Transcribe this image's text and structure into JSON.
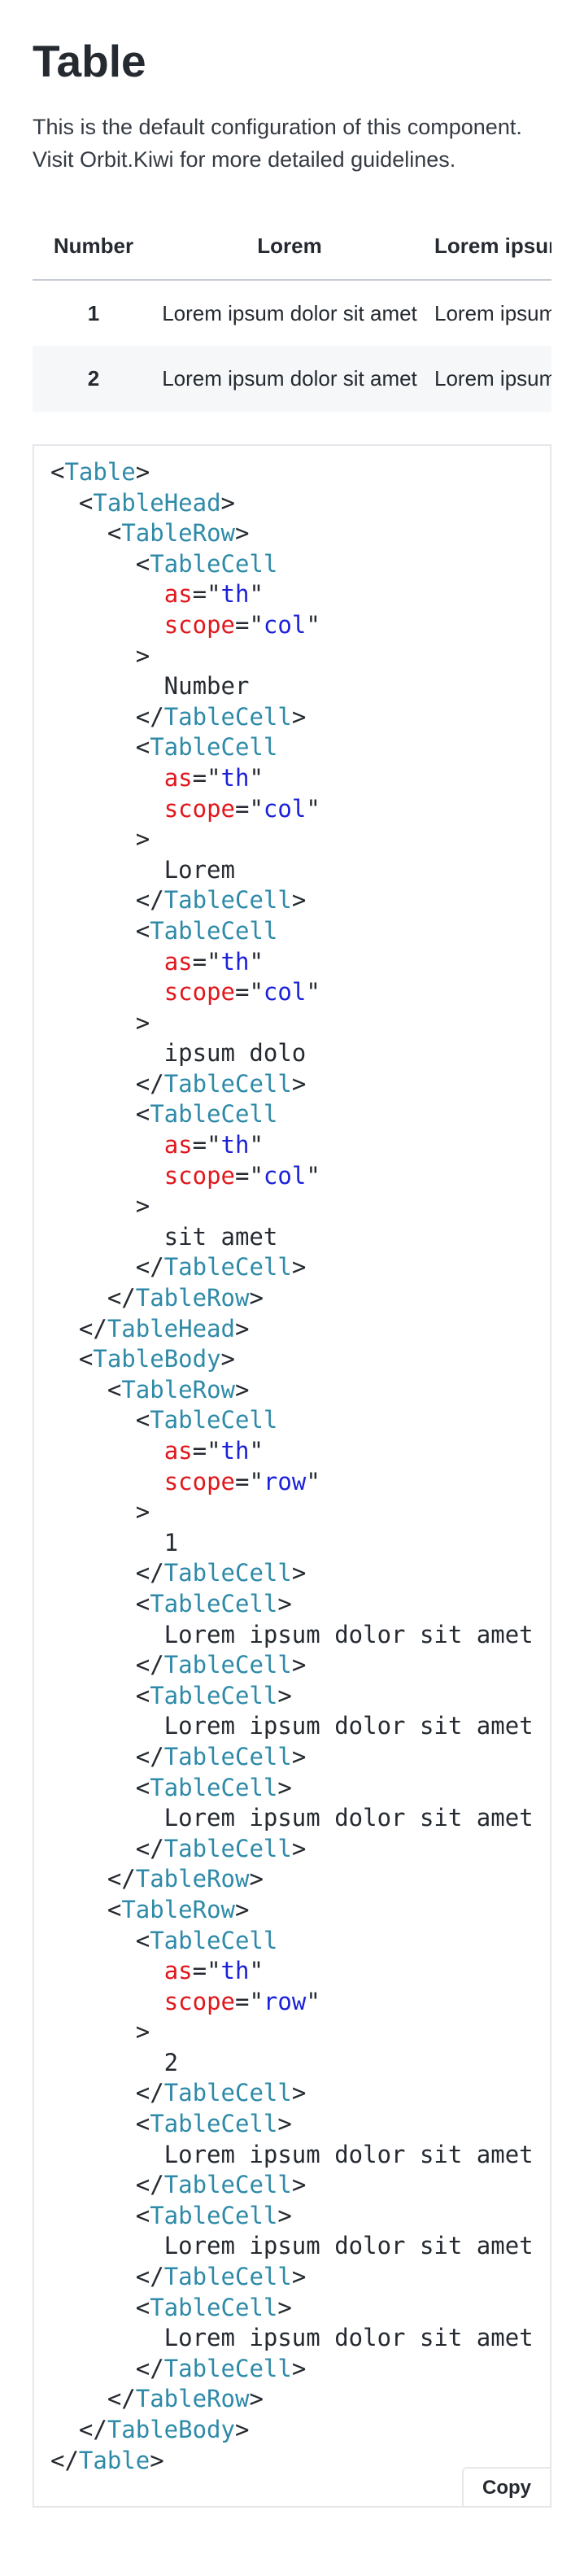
{
  "page": {
    "title": "Table",
    "description_line1": "This is the default configuration of this component.",
    "description_line2": "Visit Orbit.Kiwi for more detailed guidelines."
  },
  "table": {
    "headers": [
      "Number",
      "Lorem",
      "Lorem ipsum dolo"
    ],
    "rows": [
      {
        "number": "1",
        "cells": [
          "Lorem ipsum dolor sit amet",
          "Lorem ipsum dolor sit amet"
        ]
      },
      {
        "number": "2",
        "cells": [
          "Lorem ipsum dolor sit amet",
          "Lorem ipsum dolor sit amet"
        ]
      }
    ]
  },
  "code": {
    "lines": [
      [
        [
          0,
          "<"
        ],
        [
          1,
          "Table"
        ],
        [
          0,
          ">"
        ]
      ],
      [
        [
          0,
          "  <"
        ],
        [
          1,
          "TableHead"
        ],
        [
          0,
          ">"
        ]
      ],
      [
        [
          0,
          "    <"
        ],
        [
          1,
          "TableRow"
        ],
        [
          0,
          ">"
        ]
      ],
      [
        [
          0,
          "      <"
        ],
        [
          1,
          "TableCell"
        ]
      ],
      [
        [
          0,
          "        "
        ],
        [
          2,
          "as"
        ],
        [
          0,
          "=\""
        ],
        [
          3,
          "th"
        ],
        [
          0,
          "\""
        ]
      ],
      [
        [
          0,
          "        "
        ],
        [
          2,
          "scope"
        ],
        [
          0,
          "=\""
        ],
        [
          3,
          "col"
        ],
        [
          0,
          "\""
        ]
      ],
      [
        [
          0,
          "      >"
        ]
      ],
      [
        [
          0,
          "        Number"
        ]
      ],
      [
        [
          0,
          "      </"
        ],
        [
          1,
          "TableCell"
        ],
        [
          0,
          ">"
        ]
      ],
      [
        [
          0,
          "      <"
        ],
        [
          1,
          "TableCell"
        ]
      ],
      [
        [
          0,
          "        "
        ],
        [
          2,
          "as"
        ],
        [
          0,
          "=\""
        ],
        [
          3,
          "th"
        ],
        [
          0,
          "\""
        ]
      ],
      [
        [
          0,
          "        "
        ],
        [
          2,
          "scope"
        ],
        [
          0,
          "=\""
        ],
        [
          3,
          "col"
        ],
        [
          0,
          "\""
        ]
      ],
      [
        [
          0,
          "      >"
        ]
      ],
      [
        [
          0,
          "        Lorem"
        ]
      ],
      [
        [
          0,
          "      </"
        ],
        [
          1,
          "TableCell"
        ],
        [
          0,
          ">"
        ]
      ],
      [
        [
          0,
          "      <"
        ],
        [
          1,
          "TableCell"
        ]
      ],
      [
        [
          0,
          "        "
        ],
        [
          2,
          "as"
        ],
        [
          0,
          "=\""
        ],
        [
          3,
          "th"
        ],
        [
          0,
          "\""
        ]
      ],
      [
        [
          0,
          "        "
        ],
        [
          2,
          "scope"
        ],
        [
          0,
          "=\""
        ],
        [
          3,
          "col"
        ],
        [
          0,
          "\""
        ]
      ],
      [
        [
          0,
          "      >"
        ]
      ],
      [
        [
          0,
          "        ipsum dolo"
        ]
      ],
      [
        [
          0,
          "      </"
        ],
        [
          1,
          "TableCell"
        ],
        [
          0,
          ">"
        ]
      ],
      [
        [
          0,
          "      <"
        ],
        [
          1,
          "TableCell"
        ]
      ],
      [
        [
          0,
          "        "
        ],
        [
          2,
          "as"
        ],
        [
          0,
          "=\""
        ],
        [
          3,
          "th"
        ],
        [
          0,
          "\""
        ]
      ],
      [
        [
          0,
          "        "
        ],
        [
          2,
          "scope"
        ],
        [
          0,
          "=\""
        ],
        [
          3,
          "col"
        ],
        [
          0,
          "\""
        ]
      ],
      [
        [
          0,
          "      >"
        ]
      ],
      [
        [
          0,
          "        sit amet"
        ]
      ],
      [
        [
          0,
          "      </"
        ],
        [
          1,
          "TableCell"
        ],
        [
          0,
          ">"
        ]
      ],
      [
        [
          0,
          "    </"
        ],
        [
          1,
          "TableRow"
        ],
        [
          0,
          ">"
        ]
      ],
      [
        [
          0,
          "  </"
        ],
        [
          1,
          "TableHead"
        ],
        [
          0,
          ">"
        ]
      ],
      [
        [
          0,
          "  <"
        ],
        [
          1,
          "TableBody"
        ],
        [
          0,
          ">"
        ]
      ],
      [
        [
          0,
          "    <"
        ],
        [
          1,
          "TableRow"
        ],
        [
          0,
          ">"
        ]
      ],
      [
        [
          0,
          "      <"
        ],
        [
          1,
          "TableCell"
        ]
      ],
      [
        [
          0,
          "        "
        ],
        [
          2,
          "as"
        ],
        [
          0,
          "=\""
        ],
        [
          3,
          "th"
        ],
        [
          0,
          "\""
        ]
      ],
      [
        [
          0,
          "        "
        ],
        [
          2,
          "scope"
        ],
        [
          0,
          "=\""
        ],
        [
          3,
          "row"
        ],
        [
          0,
          "\""
        ]
      ],
      [
        [
          0,
          "      >"
        ]
      ],
      [
        [
          0,
          "        1"
        ]
      ],
      [
        [
          0,
          "      </"
        ],
        [
          1,
          "TableCell"
        ],
        [
          0,
          ">"
        ]
      ],
      [
        [
          0,
          "      <"
        ],
        [
          1,
          "TableCell"
        ],
        [
          0,
          ">"
        ]
      ],
      [
        [
          0,
          "        Lorem ipsum dolor sit amet"
        ]
      ],
      [
        [
          0,
          "      </"
        ],
        [
          1,
          "TableCell"
        ],
        [
          0,
          ">"
        ]
      ],
      [
        [
          0,
          "      <"
        ],
        [
          1,
          "TableCell"
        ],
        [
          0,
          ">"
        ]
      ],
      [
        [
          0,
          "        Lorem ipsum dolor sit amet"
        ]
      ],
      [
        [
          0,
          "      </"
        ],
        [
          1,
          "TableCell"
        ],
        [
          0,
          ">"
        ]
      ],
      [
        [
          0,
          "      <"
        ],
        [
          1,
          "TableCell"
        ],
        [
          0,
          ">"
        ]
      ],
      [
        [
          0,
          "        Lorem ipsum dolor sit amet"
        ]
      ],
      [
        [
          0,
          "      </"
        ],
        [
          1,
          "TableCell"
        ],
        [
          0,
          ">"
        ]
      ],
      [
        [
          0,
          "    </"
        ],
        [
          1,
          "TableRow"
        ],
        [
          0,
          ">"
        ]
      ],
      [
        [
          0,
          "    <"
        ],
        [
          1,
          "TableRow"
        ],
        [
          0,
          ">"
        ]
      ],
      [
        [
          0,
          "      <"
        ],
        [
          1,
          "TableCell"
        ]
      ],
      [
        [
          0,
          "        "
        ],
        [
          2,
          "as"
        ],
        [
          0,
          "=\""
        ],
        [
          3,
          "th"
        ],
        [
          0,
          "\""
        ]
      ],
      [
        [
          0,
          "        "
        ],
        [
          2,
          "scope"
        ],
        [
          0,
          "=\""
        ],
        [
          3,
          "row"
        ],
        [
          0,
          "\""
        ]
      ],
      [
        [
          0,
          "      >"
        ]
      ],
      [
        [
          0,
          "        2"
        ]
      ],
      [
        [
          0,
          "      </"
        ],
        [
          1,
          "TableCell"
        ],
        [
          0,
          ">"
        ]
      ],
      [
        [
          0,
          "      <"
        ],
        [
          1,
          "TableCell"
        ],
        [
          0,
          ">"
        ]
      ],
      [
        [
          0,
          "        Lorem ipsum dolor sit amet"
        ]
      ],
      [
        [
          0,
          "      </"
        ],
        [
          1,
          "TableCell"
        ],
        [
          0,
          ">"
        ]
      ],
      [
        [
          0,
          "      <"
        ],
        [
          1,
          "TableCell"
        ],
        [
          0,
          ">"
        ]
      ],
      [
        [
          0,
          "        Lorem ipsum dolor sit amet"
        ]
      ],
      [
        [
          0,
          "      </"
        ],
        [
          1,
          "TableCell"
        ],
        [
          0,
          ">"
        ]
      ],
      [
        [
          0,
          "      <"
        ],
        [
          1,
          "TableCell"
        ],
        [
          0,
          ">"
        ]
      ],
      [
        [
          0,
          "        Lorem ipsum dolor sit amet"
        ]
      ],
      [
        [
          0,
          "      </"
        ],
        [
          1,
          "TableCell"
        ],
        [
          0,
          ">"
        ]
      ],
      [
        [
          0,
          "    </"
        ],
        [
          1,
          "TableRow"
        ],
        [
          0,
          ">"
        ]
      ],
      [
        [
          0,
          "  </"
        ],
        [
          1,
          "TableBody"
        ],
        [
          0,
          ">"
        ]
      ],
      [
        [
          0,
          "</"
        ],
        [
          1,
          "Table"
        ],
        [
          0,
          ">"
        ]
      ]
    ],
    "copy_label": "Copy"
  },
  "colors": {
    "tag": "#2e8aa8",
    "attribute": "#e0171c",
    "value": "#1b21d8",
    "row_alt_bg": "#f5f7f9"
  }
}
